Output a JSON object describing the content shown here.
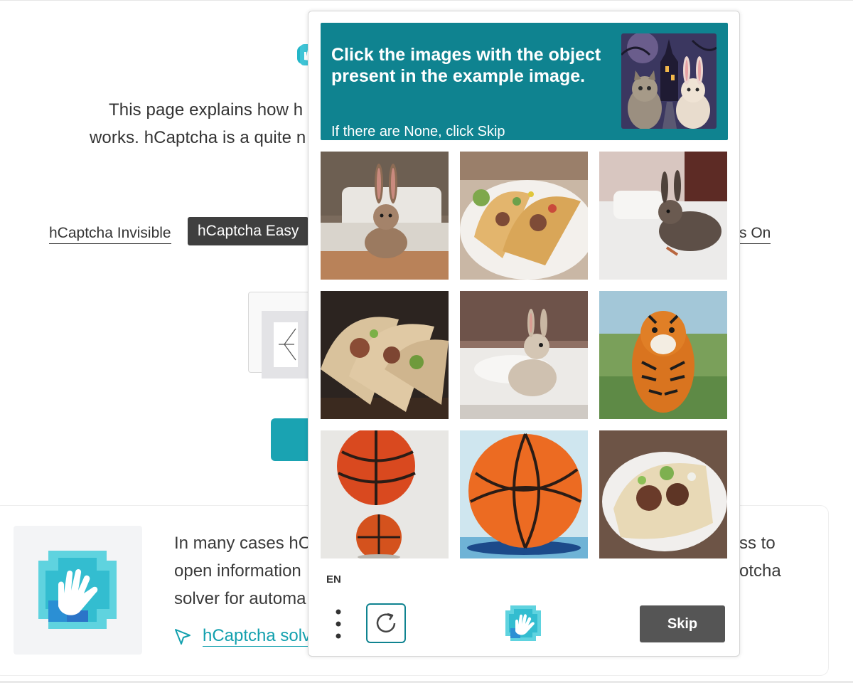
{
  "background": {
    "intro_line1": "This page explains how h",
    "intro_line2": "works. hCaptcha is a quite n",
    "tabs": [
      {
        "label": "hCaptcha Invisible",
        "active": false
      },
      {
        "label": "hCaptcha Easy",
        "active": true
      },
      {
        "label": "s On",
        "active": false
      }
    ],
    "card": {
      "line1_left": "In many cases hC",
      "line1_right": "ss to",
      "line2_left": "open information",
      "line2_right": "otcha",
      "line3_left": "solver for automa",
      "link_text": "hCaptcha solv"
    }
  },
  "captcha": {
    "prompt_title": "Click the images with the object present in the example image.",
    "prompt_subtitle": "If there are None, click Skip",
    "example_image": "cat and rabbit in front of haunted castle",
    "tiles": [
      {
        "subject": "rabbit on bed"
      },
      {
        "subject": "tacos on plate"
      },
      {
        "subject": "rabbit on bed"
      },
      {
        "subject": "tacos"
      },
      {
        "subject": "rabbit on pillows"
      },
      {
        "subject": "tiger in grass"
      },
      {
        "subject": "basketballs"
      },
      {
        "subject": "basketball painting"
      },
      {
        "subject": "taco on plate"
      }
    ],
    "language": "EN",
    "skip_label": "Skip",
    "colors": {
      "accent": "#0f8390",
      "skip_bg": "#555555"
    }
  }
}
